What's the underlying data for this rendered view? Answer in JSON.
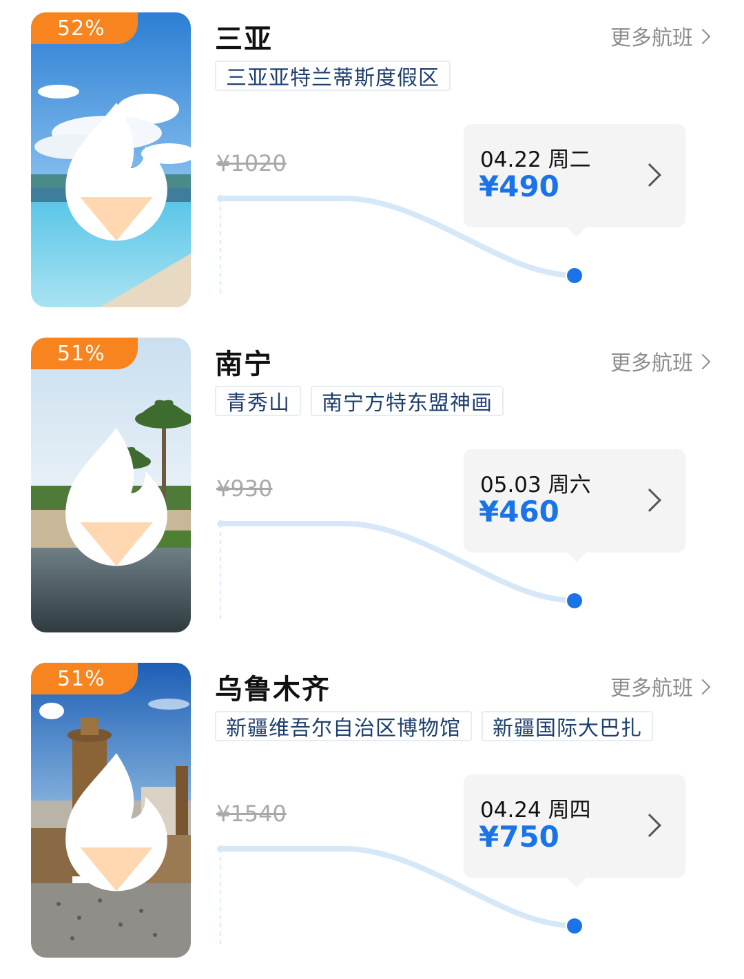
{
  "cards": [
    {
      "discount": "52%",
      "city": "三亚",
      "more_label": "更多航班",
      "tags": [
        "三亚亚特兰蒂斯度假区"
      ],
      "original_price": "¥1020",
      "date": "04.22 周二",
      "price": "¥490",
      "image": "beach-pool"
    },
    {
      "discount": "51%",
      "city": "南宁",
      "more_label": "更多航班",
      "tags": [
        "青秀山",
        "南宁方特东盟神画"
      ],
      "original_price": "¥930",
      "date": "05.03 周六",
      "price": "¥460",
      "image": "palm-lake"
    },
    {
      "discount": "51%",
      "city": "乌鲁木齐",
      "more_label": "更多航班",
      "tags": [
        "新疆维吾尔自治区博物馆",
        "新疆国际大巴扎"
      ],
      "original_price": "¥1540",
      "date": "04.24 周四",
      "price": "¥750",
      "image": "bazaar-tower"
    }
  ],
  "colors": {
    "badge": "#f7841f",
    "price": "#1a73e8",
    "trend_line": "#d6e8f8",
    "dot": "#1a73e8"
  }
}
